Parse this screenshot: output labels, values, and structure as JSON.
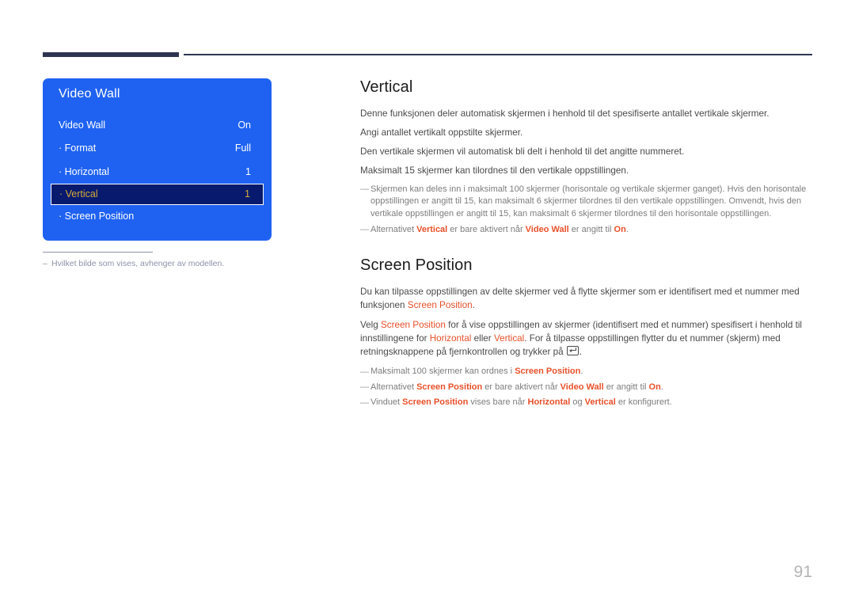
{
  "osd": {
    "title": "Video Wall",
    "rows": [
      {
        "label": "Video Wall",
        "value": "On",
        "selected": false
      },
      {
        "label": "· Format",
        "value": "Full",
        "selected": false
      },
      {
        "label": "· Horizontal",
        "value": "1",
        "selected": false
      },
      {
        "label": "· Vertical",
        "value": "1",
        "selected": true
      },
      {
        "label": "· Screen Position",
        "value": "",
        "selected": false
      }
    ],
    "accent_color": "#1f62f2",
    "selected_bg_color": "#071a6e",
    "selected_text_color": "#d7a93a"
  },
  "left_footnote": {
    "dash": "–",
    "text": "Hvilket bilde som vises, avhenger av modellen."
  },
  "vertical_section": {
    "heading": "Vertical",
    "lines": [
      "Denne funksjonen deler automatisk skjermen i henhold til det spesifiserte antallet vertikale skjermer.",
      "Angi antallet vertikalt oppstilte skjermer.",
      "Den vertikale skjermen vil automatisk bli delt i henhold til det angitte nummeret.",
      "Maksimalt 15 skjermer kan tilordnes til den vertikale oppstillingen."
    ],
    "notes": [
      {
        "dash": "—",
        "parts": [
          {
            "t": "Skjermen kan deles inn i maksimalt 100 skjermer (horisontale og vertikale skjermer ganget). Hvis den horisontale oppstillingen er angitt til 15, kan maksimalt 6 skjermer tilordnes til den vertikale oppstillingen. Omvendt, hvis den vertikale oppstillingen er angitt til 15, kan maksimalt 6 skjermer tilordnes til den horisontale oppstillingen.",
            "s": "plain"
          }
        ]
      },
      {
        "dash": "—",
        "parts": [
          {
            "t": "Alternativet ",
            "s": "plain"
          },
          {
            "t": "Vertical",
            "s": "bold-accent"
          },
          {
            "t": " er bare aktivert når ",
            "s": "plain"
          },
          {
            "t": "Video Wall",
            "s": "bold-accent"
          },
          {
            "t": " er angitt til ",
            "s": "plain"
          },
          {
            "t": "On",
            "s": "bold-accent"
          },
          {
            "t": ".",
            "s": "plain"
          }
        ]
      }
    ]
  },
  "screen_position_section": {
    "heading": "Screen Position",
    "paragraphs": [
      {
        "parts": [
          {
            "t": "Du kan tilpasse oppstillingen av delte skjermer ved å flytte skjermer som er identifisert med et nummer med funksjonen ",
            "s": "plain"
          },
          {
            "t": "Screen Position",
            "s": "accent"
          },
          {
            "t": ".",
            "s": "plain"
          }
        ]
      },
      {
        "parts": [
          {
            "t": "Velg ",
            "s": "plain"
          },
          {
            "t": "Screen Position",
            "s": "accent"
          },
          {
            "t": " for å vise oppstillingen av skjermer (identifisert med et nummer) spesifisert i henhold til innstillingene for ",
            "s": "plain"
          },
          {
            "t": "Horizontal",
            "s": "accent"
          },
          {
            "t": " eller ",
            "s": "plain"
          },
          {
            "t": "Vertical",
            "s": "accent"
          },
          {
            "t": ". For å tilpasse oppstillingen flytter du et nummer (skjerm) med retningsknappene på fjernkontrollen og trykker på ",
            "s": "plain"
          },
          {
            "t": "",
            "s": "enter-icon"
          },
          {
            "t": ".",
            "s": "plain"
          }
        ]
      }
    ],
    "notes": [
      {
        "dash": "—",
        "parts": [
          {
            "t": "Maksimalt 100 skjermer kan ordnes i ",
            "s": "plain"
          },
          {
            "t": "Screen Position",
            "s": "bold-accent"
          },
          {
            "t": ".",
            "s": "plain"
          }
        ]
      },
      {
        "dash": "—",
        "parts": [
          {
            "t": "Alternativet ",
            "s": "plain"
          },
          {
            "t": "Screen Position",
            "s": "bold-accent"
          },
          {
            "t": " er bare aktivert når ",
            "s": "plain"
          },
          {
            "t": "Video Wall",
            "s": "bold-accent"
          },
          {
            "t": " er angitt til ",
            "s": "plain"
          },
          {
            "t": "On",
            "s": "bold-accent"
          },
          {
            "t": ".",
            "s": "plain"
          }
        ]
      },
      {
        "dash": "—",
        "parts": [
          {
            "t": "Vinduet ",
            "s": "plain"
          },
          {
            "t": "Screen Position",
            "s": "bold-accent"
          },
          {
            "t": " vises bare når ",
            "s": "plain"
          },
          {
            "t": "Horizontal",
            "s": "bold-accent"
          },
          {
            "t": " og ",
            "s": "plain"
          },
          {
            "t": "Vertical",
            "s": "bold-accent"
          },
          {
            "t": " er konfigurert.",
            "s": "plain"
          }
        ]
      }
    ]
  },
  "page_number": "91"
}
